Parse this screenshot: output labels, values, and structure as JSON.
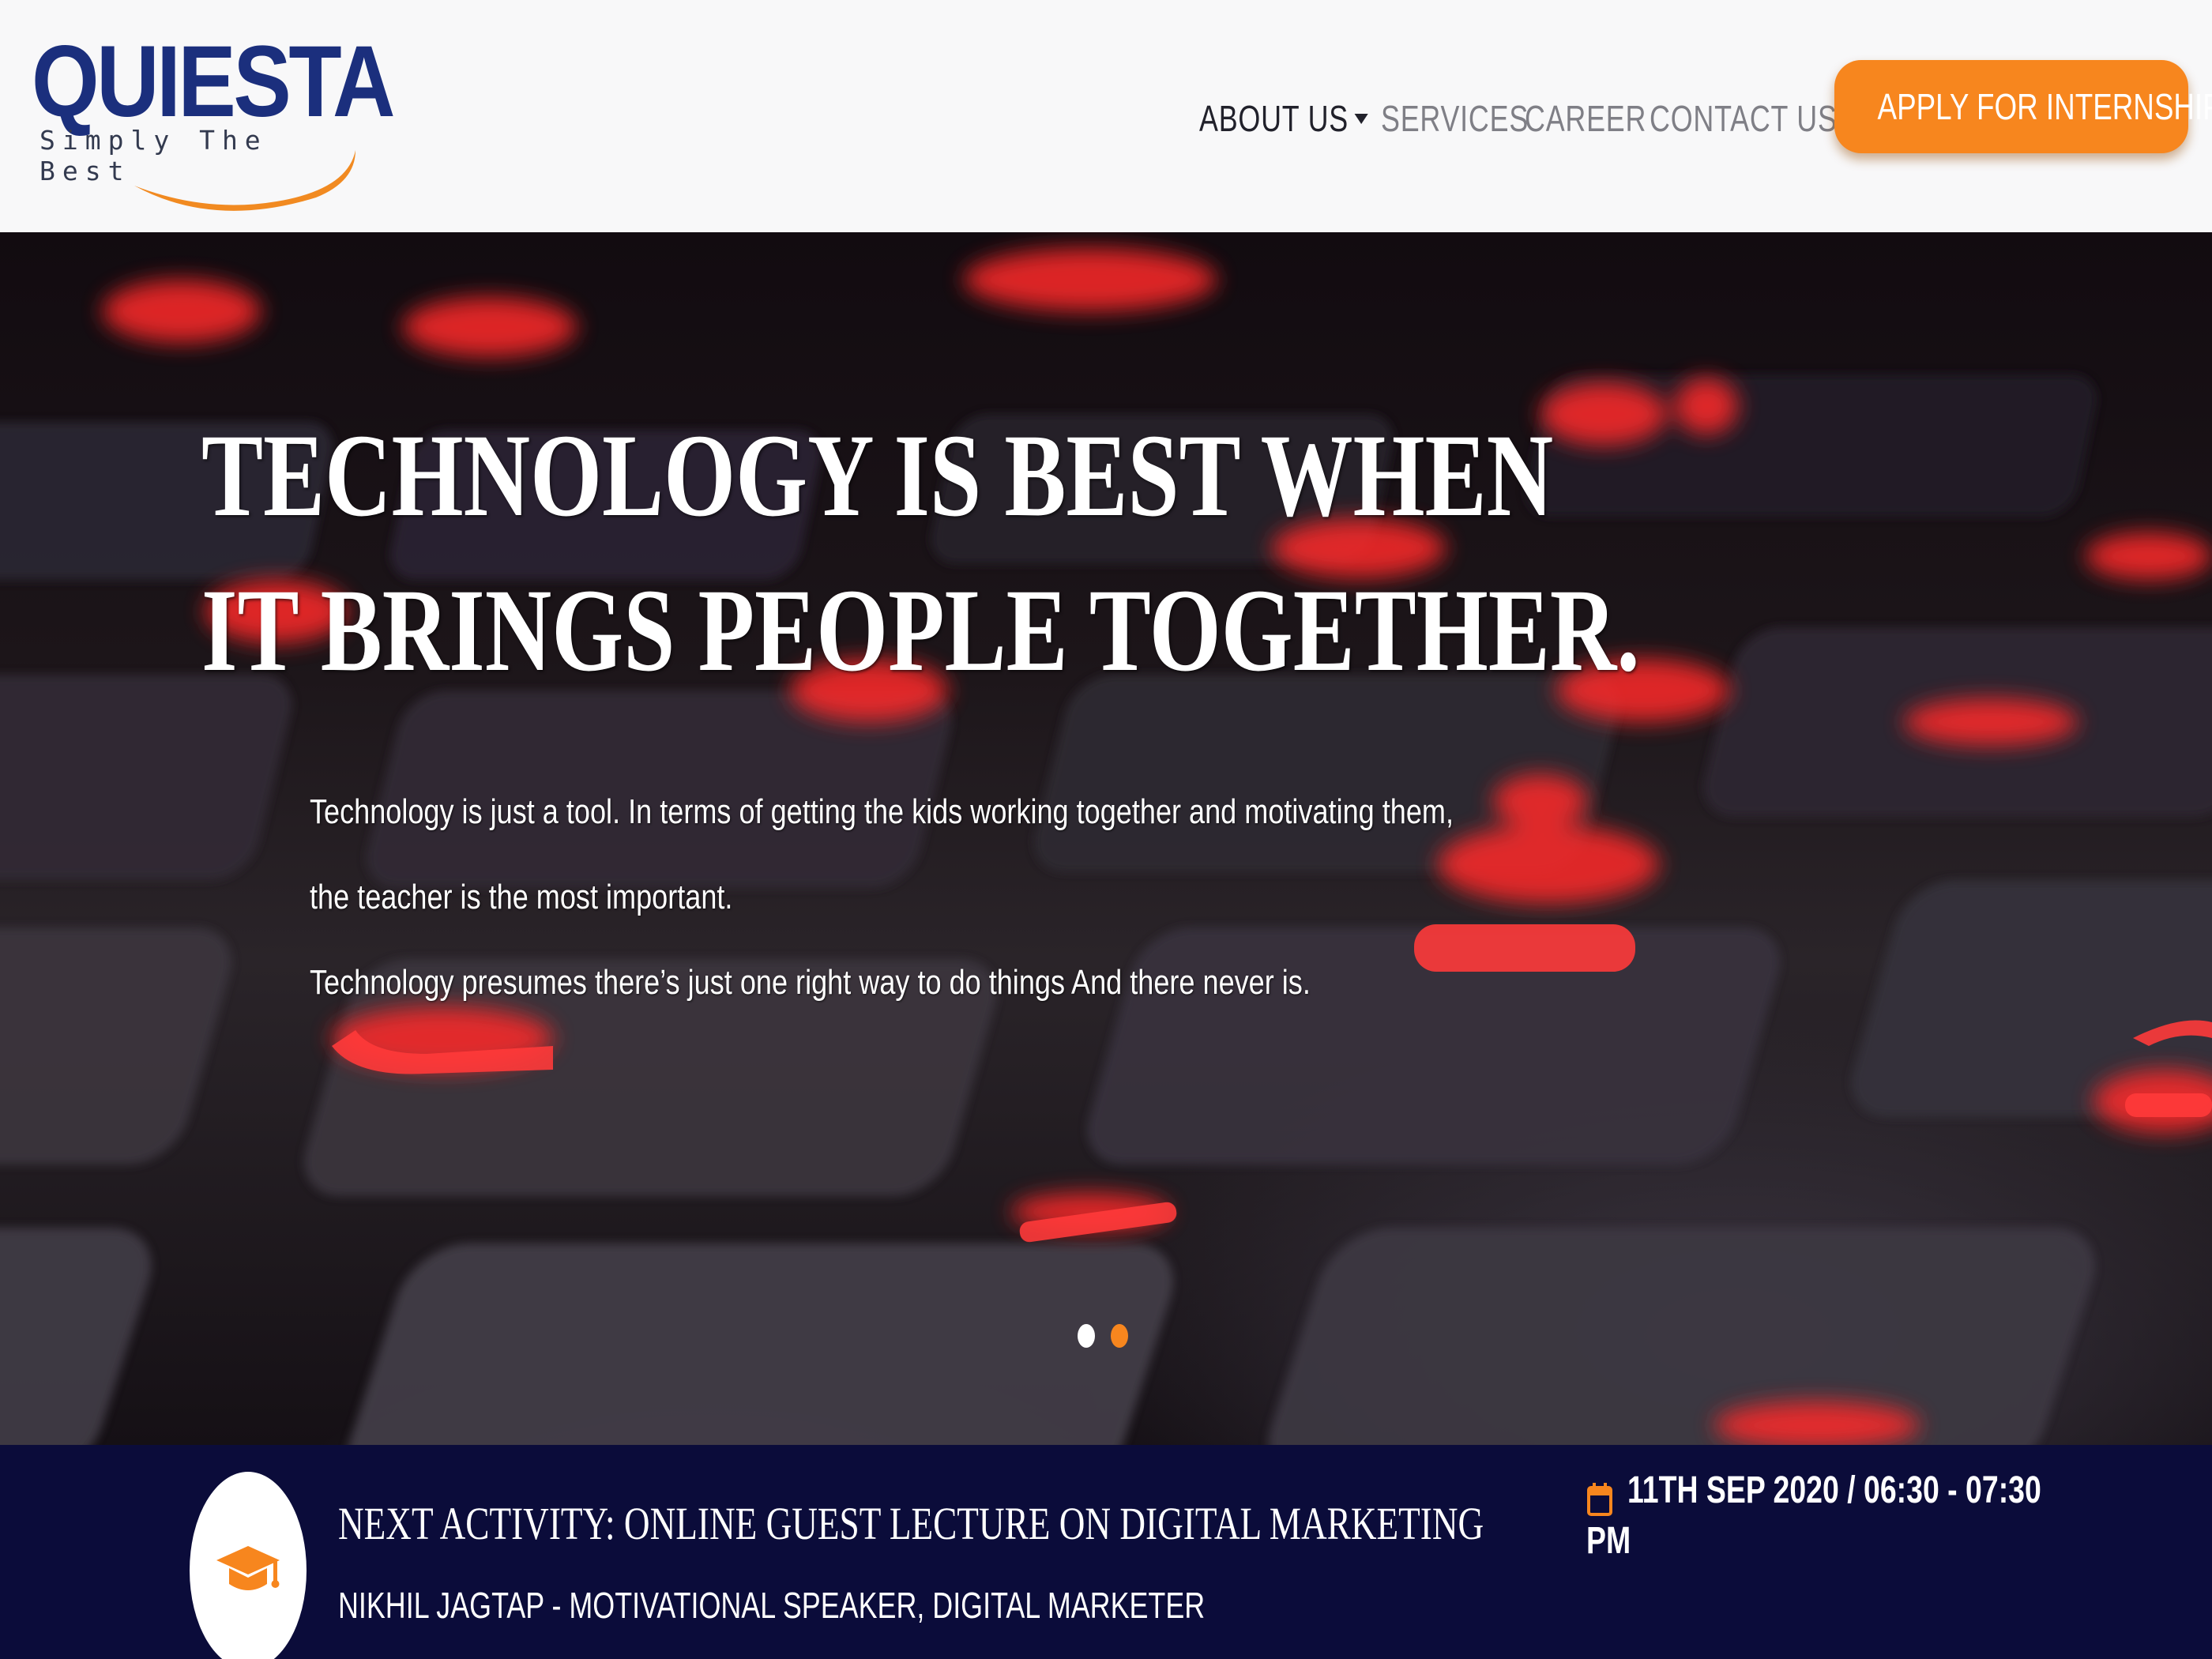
{
  "brand": {
    "name": "QUIESTA",
    "tagline": "Simply The Best",
    "colors": {
      "navy": "#1b2f7d",
      "orange": "#f7861e"
    }
  },
  "nav": {
    "items": [
      {
        "label": "ABOUT US",
        "has_dropdown": true,
        "active": true
      },
      {
        "label": "SERVICES"
      },
      {
        "label": "CAREER"
      },
      {
        "label": "CONTACT US"
      }
    ],
    "cta_label": "APPLY FOR INTERNSHIP"
  },
  "hero": {
    "title_lines": [
      "TECHNOLOGY IS BEST WHEN",
      "IT BRINGS PEOPLE TOGETHER."
    ],
    "body_lines": [
      "Technology is just a tool. In terms of getting the kids working together and motivating them,",
      "the teacher is the most important.",
      "Technology presumes there’s just one right way to do things And there never is."
    ],
    "background": "dark keyboard with red backlit keys",
    "slides_total": 2,
    "active_slide": 2
  },
  "activity": {
    "icon": "graduation-cap-icon",
    "title": "NEXT ACTIVITY: ONLINE GUEST LECTURE ON DIGITAL MARKETING",
    "speaker": "NIKHIL JAGTAP - MOTIVATIONAL SPEAKER, DIGITAL MARKETER",
    "date_icon": "calendar-icon",
    "date_line1": "11TH SEP 2020 / 06:30 - 07:30",
    "date_line2": "PM"
  }
}
